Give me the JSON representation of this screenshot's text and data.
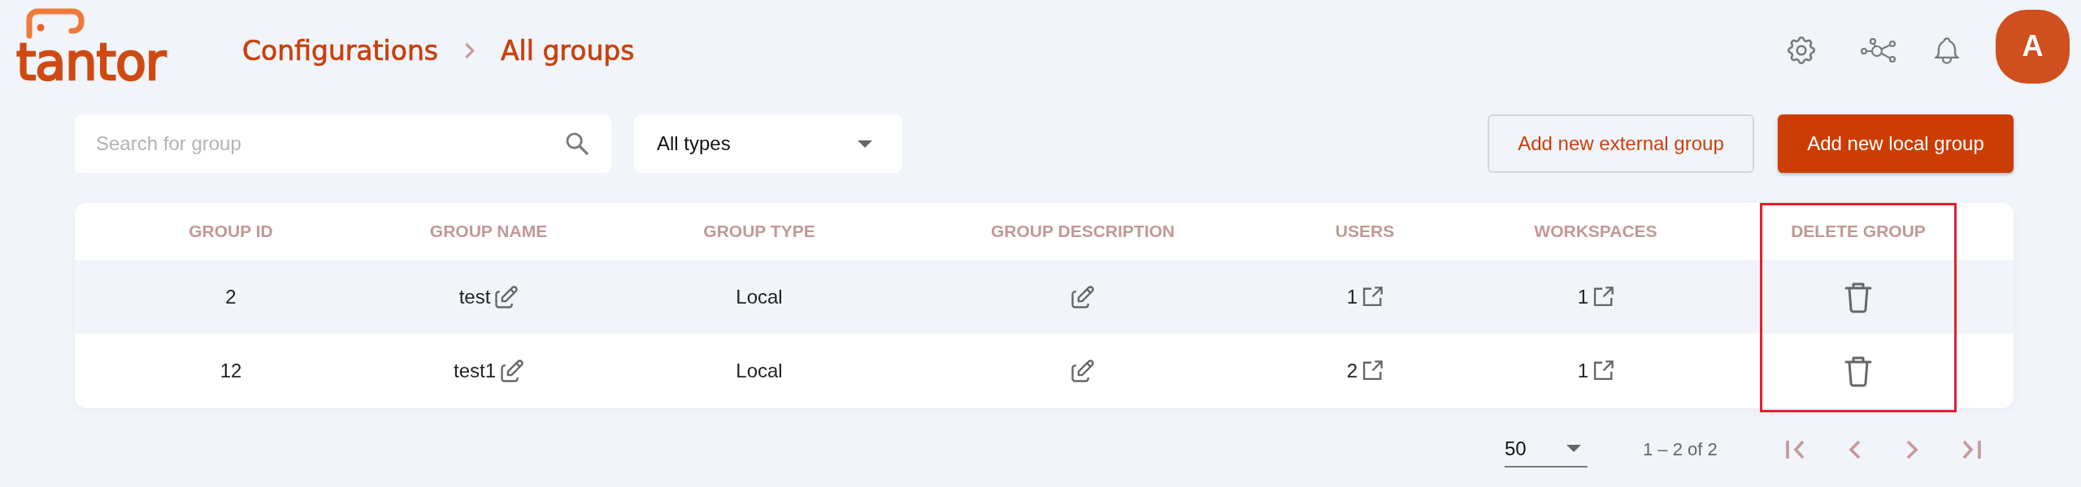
{
  "logo": {
    "text": "tantor"
  },
  "breadcrumb": [
    {
      "label": "Configurations"
    },
    {
      "label": "All groups"
    }
  ],
  "user": {
    "initial": "A"
  },
  "search": {
    "placeholder": "Search for group"
  },
  "type_filter": {
    "value": "All types"
  },
  "buttons": [
    {
      "label": "Add new external group",
      "kind": "outline"
    },
    {
      "label": "Add new local group",
      "kind": "primary"
    }
  ],
  "table": {
    "columns": [
      {
        "label": "GROUP ID",
        "highlighted": false
      },
      {
        "label": "GROUP NAME",
        "highlighted": false
      },
      {
        "label": "GROUP TYPE",
        "highlighted": false
      },
      {
        "label": "GROUP DESCRIPTION",
        "highlighted": false
      },
      {
        "label": "USERS",
        "highlighted": false
      },
      {
        "label": "WORKSPACES",
        "highlighted": false
      },
      {
        "label": "DELETE GROUP",
        "highlighted": true
      }
    ],
    "rows": [
      {
        "group_id": "2",
        "group_name": "test",
        "group_type": "Local",
        "users": "1",
        "workspaces": "1"
      },
      {
        "group_id": "12",
        "group_name": "test1",
        "group_type": "Local",
        "users": "2",
        "workspaces": "1"
      }
    ]
  },
  "pagination": {
    "page_size": "50",
    "range": "1 – 2 of 2"
  }
}
